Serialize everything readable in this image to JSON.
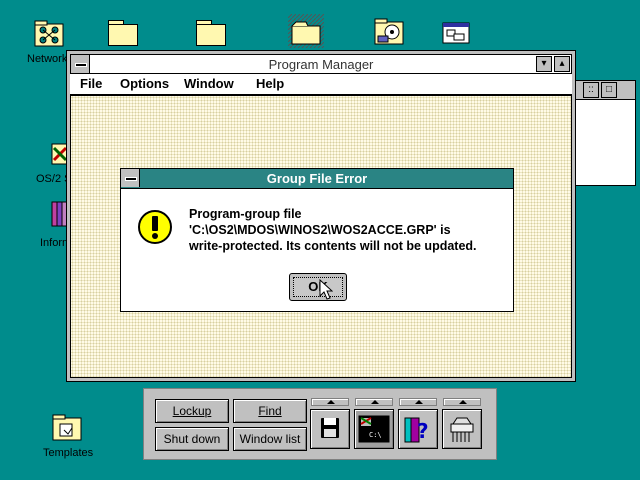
{
  "desktop": {
    "icons": [
      {
        "label": "Network"
      },
      {
        "label": "OS/2 S"
      },
      {
        "label": "Inform"
      },
      {
        "label": "Templates"
      }
    ]
  },
  "program_manager": {
    "title": "Program Manager",
    "menu": [
      {
        "label": "File",
        "mnemonic": "F"
      },
      {
        "label": "Options",
        "mnemonic": "O"
      },
      {
        "label": "Window",
        "mnemonic": "W"
      },
      {
        "label": "Help",
        "mnemonic": "H"
      }
    ]
  },
  "dialog": {
    "title": "Group File Error",
    "message_lines": [
      "Program-group file",
      "'C:\\OS2\\MDOS\\WINOS2\\WOS2ACCE.GRP' is",
      "write-protected. Its contents will not be updated."
    ],
    "ok_label": "OK"
  },
  "launchpad": {
    "lockup": "Lockup",
    "find": "Find",
    "shutdown": "Shut down",
    "window_list": "Window list"
  },
  "colors": {
    "desktop": "#008c8c",
    "dialog_title": "#2a8484",
    "client": "#fffbe6"
  }
}
